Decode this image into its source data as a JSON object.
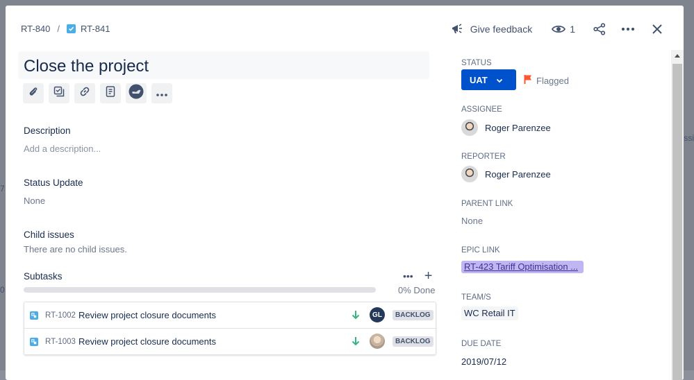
{
  "breadcrumb": {
    "parent": "RT-840",
    "separator": "/",
    "current": "RT-841"
  },
  "header": {
    "feedback_label": "Give feedback",
    "watch_count": "1"
  },
  "issue": {
    "title": "Close the project"
  },
  "description": {
    "label": "Description",
    "placeholder": "Add a description..."
  },
  "status_update": {
    "label": "Status Update",
    "value": "None"
  },
  "child_issues": {
    "label": "Child issues",
    "empty_text": "There are no child issues."
  },
  "subtasks": {
    "label": "Subtasks",
    "more": "•••",
    "add": "+",
    "progress_label": "0% Done",
    "progress_fraction": 0,
    "items": [
      {
        "key": "RT-1002",
        "summary": "Review project closure documents",
        "assignee_initials": "GL",
        "status": "BACKLOG"
      },
      {
        "key": "RT-1003",
        "summary": "Review project closure documents",
        "assignee_initials": "",
        "status": "BACKLOG"
      }
    ]
  },
  "sidebar": {
    "status_label": "STATUS",
    "status_value": "UAT",
    "flag_label": "Flagged",
    "assignee_label": "ASSIGNEE",
    "assignee_name": "Roger Parenzee",
    "reporter_label": "REPORTER",
    "reporter_name": "Roger Parenzee",
    "parent_link_label": "PARENT LINK",
    "parent_link_value": "None",
    "epic_link_label": "EPIC LINK",
    "epic_link_value": "RT-423 Tariff Optimisation ...",
    "team_label": "TEAM/S",
    "team_value": "WC Retail IT",
    "due_date_label": "DUE DATE",
    "due_date_value": "2019/07/12"
  },
  "background": {
    "frag1": "issi",
    "frag2": "7",
    "frag3": "0"
  },
  "colors": {
    "primary": "#0052cc",
    "flag": "#ff5630",
    "epic": "#c0b6f2",
    "priority_low": "#36b37e"
  }
}
